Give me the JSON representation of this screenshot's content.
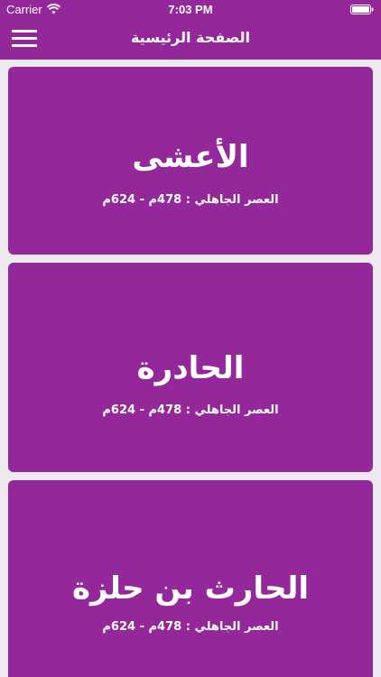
{
  "status_bar": {
    "carrier": "Carrier",
    "time": "7:03 PM",
    "icons": [
      "wifi-icon",
      "battery-icon"
    ]
  },
  "nav": {
    "title": "الصفحة الرئيسية",
    "menu_icon": "menu-icon"
  },
  "colors": {
    "accent": "#94289a",
    "background": "#eeeaf0",
    "text": "#ffffff"
  },
  "poets": [
    {
      "name": "الأعشى",
      "era": "العصر الجاهلي : 478م - 624م"
    },
    {
      "name": "الحادرة",
      "era": "العصر الجاهلي : 478م - 624م"
    },
    {
      "name": "الحارث بن حلزة",
      "era": "العصر الجاهلي : 478م - 624م"
    }
  ]
}
